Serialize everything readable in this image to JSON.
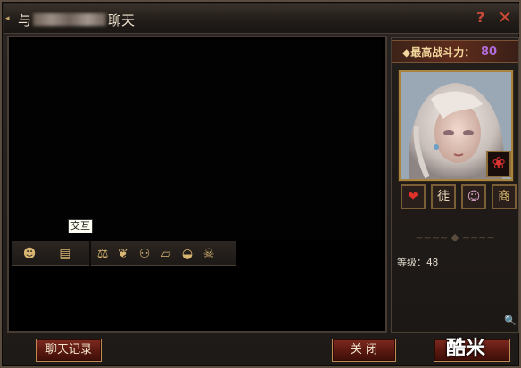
{
  "window": {
    "title_prefix": "与",
    "title_suffix": "聊天",
    "help_label": "?",
    "close_label": "✕"
  },
  "toolbar": {
    "tools": [
      {
        "icon": "smiley-icon",
        "glyph": "☻"
      },
      {
        "icon": "interact-icon",
        "glyph": "▤"
      },
      {
        "icon": "scales-icon",
        "glyph": "⚖"
      },
      {
        "icon": "handshake-icon",
        "glyph": "❦"
      },
      {
        "icon": "people-icon",
        "glyph": "⚇"
      },
      {
        "icon": "scroll-icon",
        "glyph": "▱"
      },
      {
        "icon": "mask-icon",
        "glyph": "◒"
      },
      {
        "icon": "skull-icon",
        "glyph": "☠"
      }
    ],
    "tooltip": "交互"
  },
  "profile": {
    "power_label": "◆最高战斗力：",
    "power_value": "80",
    "level_label": "等级：",
    "level_value": "48",
    "actions": [
      {
        "icon": "heart-icon",
        "glyph": "❤",
        "color": "#e0302a"
      },
      {
        "icon": "apprentice-icon",
        "glyph": "徒",
        "color": "#e8d6b8"
      },
      {
        "icon": "character-icon",
        "glyph": "☺",
        "color": "#d8a0c8"
      },
      {
        "icon": "shop-icon",
        "glyph": "商",
        "color": "#e0c070"
      }
    ],
    "rose_glyph": "❀"
  },
  "buttons": {
    "history": "聊天记录",
    "close": "关 闭"
  },
  "watermark": "酷米"
}
